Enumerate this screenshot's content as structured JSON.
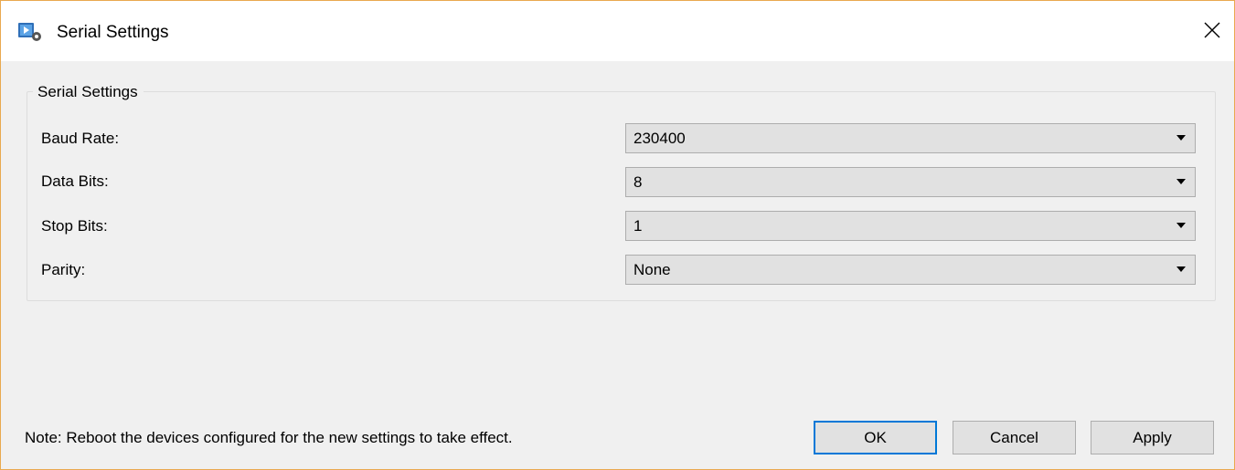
{
  "window": {
    "title": "Serial Settings",
    "icon": "app-settings-icon",
    "close": "close-icon"
  },
  "group": {
    "legend": "Serial Settings",
    "fields": [
      {
        "label": "Baud Rate:",
        "value": "230400"
      },
      {
        "label": "Data Bits:",
        "value": "8"
      },
      {
        "label": "Stop Bits:",
        "value": "1"
      },
      {
        "label": "Parity:",
        "value": "None"
      }
    ]
  },
  "footer": {
    "note": "Note: Reboot the devices configured for the new settings to take effect.",
    "ok": "OK",
    "cancel": "Cancel",
    "apply": "Apply"
  },
  "colors": {
    "accent": "#0078d7",
    "window_border": "#e9a94f"
  }
}
